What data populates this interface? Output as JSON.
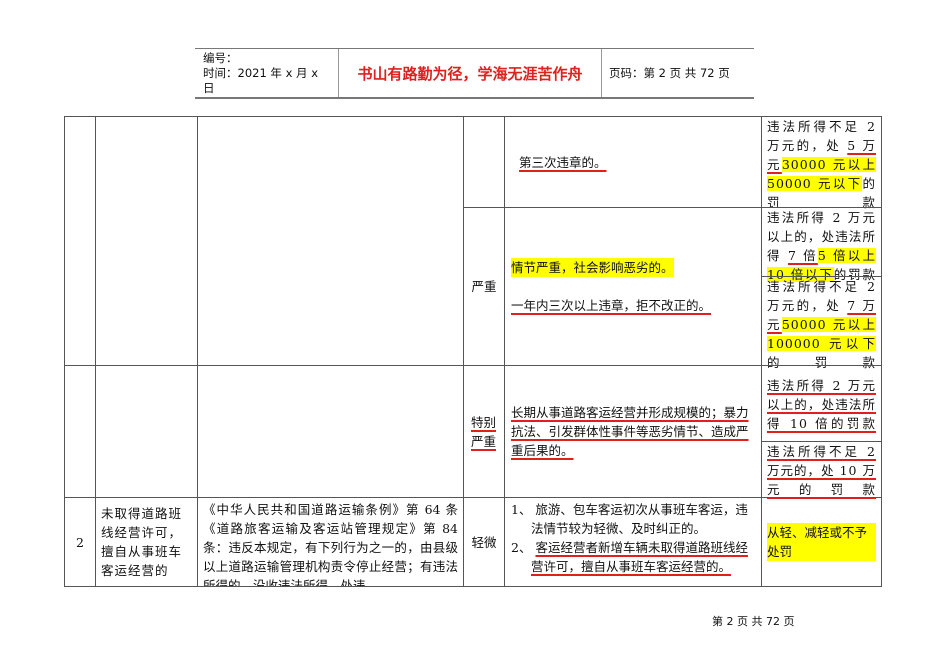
{
  "header": {
    "number_label": "编号：",
    "time_label": "时间：2021 年 x 月 x 日",
    "motto": "书山有路勤为径，学海无涯苦作舟",
    "page_label": "页码：第 2 页  共 72 页"
  },
  "rows": {
    "third": {
      "desc": "第三次违章的。",
      "penalty_a": "违法所得不足 2 万元的，处 ",
      "penalty_b": "5 万元",
      "penalty_c": "30000 元以上 50000 元以下",
      "penalty_d": "的罚款"
    },
    "serious": {
      "level": "严重",
      "desc1": "情节严重，社会影响恶劣的。",
      "desc2": "一年内三次以上违章，拒不改正的。",
      "pen1_a": "违法所得 2 万元以上的，处违法所得 ",
      "pen1_b": "7 倍",
      "pen1_c": "5 倍以上 10 倍以下",
      "pen1_d": "的罚款",
      "pen2_a": "违法所得不足 2 万元的，处 ",
      "pen2_b": "7 万元",
      "pen2_c": "50000 元以上 100000 元以下",
      "pen2_d": "的罚款"
    },
    "very_serious": {
      "level": "特别严重",
      "desc": "长期从事道路客运经营并形成规模的；暴力抗法、引发群体性事件等恶劣情节、造成严重后果的。",
      "pen1": "违法所得 2 万元以上的，处违法所得 10 倍的罚款",
      "pen2": "违法所得不足 2 万元的，处 10 万元的罚款"
    },
    "item2": {
      "no": "2",
      "violation": "未取得道路班线经营许可，擅自从事班车客运经营的",
      "basis": "《中华人民共和国道路运输条例》第 64 条《道路旅客运输及客运站管理规定》第 84 条：违反本规定，有下列行为之一的，由县级以上道路运输管理机构责令停止经营；有违法所得的，没收违法所得，处违",
      "level": "轻微",
      "desc1": "1、 旅游、包车客运初次从事班车客运，违法情节较为轻微、及时纠正的。",
      "desc2_prefix": "2、 ",
      "desc2": "客运经营者新增车辆未取得道路班线经营许可，擅自从事班车客运经营的。",
      "penalty": "从轻、减轻或不予处罚"
    }
  },
  "footer": "第 2 页 共 72 页"
}
